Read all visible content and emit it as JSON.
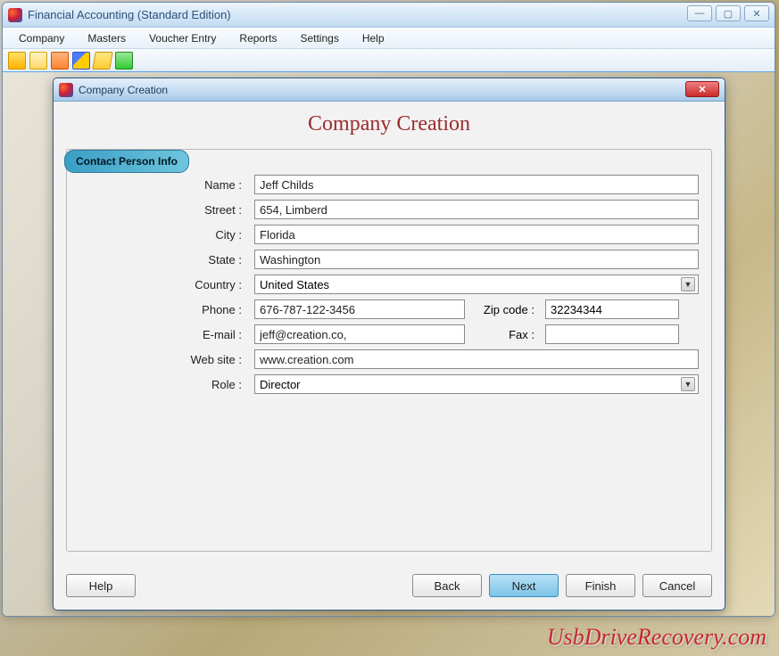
{
  "mainWindow": {
    "title": "Financial Accounting (Standard Edition)"
  },
  "menu": {
    "items": [
      "Company",
      "Masters",
      "Voucher Entry",
      "Reports",
      "Settings",
      "Help"
    ]
  },
  "modal": {
    "title": "Company Creation",
    "heading": "Company Creation",
    "sectionTab": "Contact Person Info",
    "labels": {
      "name": "Name :",
      "street": "Street :",
      "city": "City :",
      "state": "State :",
      "country": "Country :",
      "phone": "Phone :",
      "zip": "Zip code :",
      "email": "E-mail :",
      "fax": "Fax :",
      "website": "Web site :",
      "role": "Role :"
    },
    "values": {
      "name": "Jeff Childs",
      "street": "654, Limberd",
      "city": "Florida",
      "state": "Washington",
      "country": "United States",
      "phone": "676-787-122-3456",
      "zip": "32234344",
      "email": "jeff@creation.co,",
      "fax": "",
      "website": "www.creation.com",
      "role": "Director"
    },
    "buttons": {
      "help": "Help",
      "back": "Back",
      "next": "Next",
      "finish": "Finish",
      "cancel": "Cancel"
    }
  },
  "watermark": "UsbDriveRecovery.com"
}
